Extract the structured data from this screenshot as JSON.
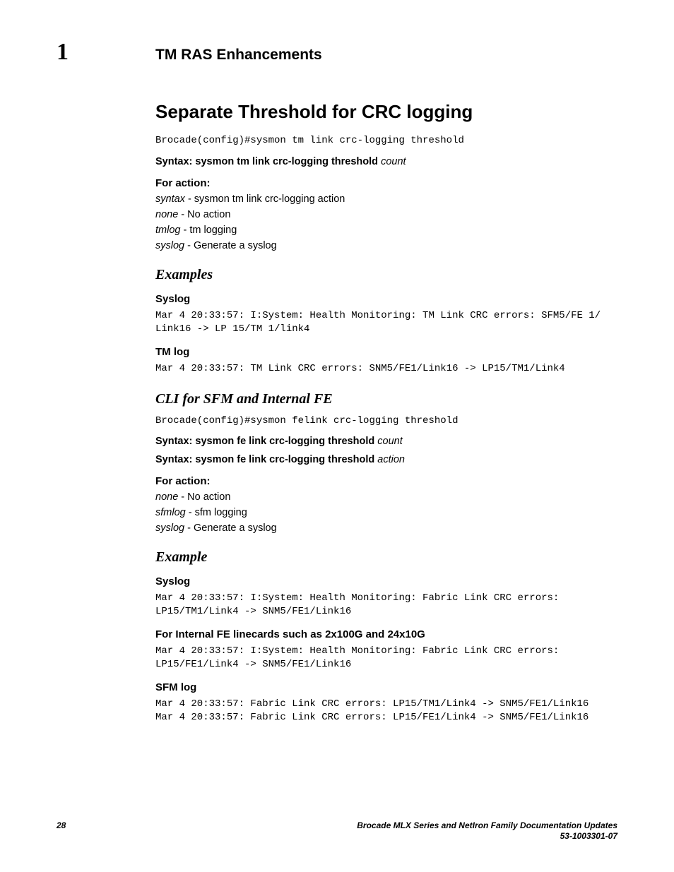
{
  "header": {
    "chapter_num": "1",
    "title": "TM RAS Enhancements"
  },
  "section": {
    "title": "Separate Threshold for CRC logging",
    "cmd1": "Brocade(config)#sysmon tm link crc-logging threshold",
    "syntax1_lead": "Syntax:  ",
    "syntax1_cmd": "sysmon tm link crc-logging threshold ",
    "syntax1_arg": "count",
    "for_action_label": "For action:",
    "action_syntax_k": "syntax",
    "action_syntax_v": " - sysmon tm link crc-logging action",
    "action_none_k": "none",
    "action_none_v": " - No action",
    "action_tmlog_k": "tmlog",
    "action_tmlog_v": " - tm logging",
    "action_syslog_k": "syslog",
    "action_syslog_v": " - Generate a syslog"
  },
  "examples1": {
    "heading": "Examples",
    "syslog_label": "Syslog",
    "syslog_text": "Mar 4 20:33:57: I:System: Health Monitoring: TM Link CRC errors: SFM5/FE 1/ Link16 -> LP 15/TM 1/link4",
    "tmlog_label": "TM log",
    "tmlog_text": "Mar 4 20:33:57: TM Link CRC errors: SNM5/FE1/Link16 -> LP15/TM1/Link4"
  },
  "cli": {
    "heading": "CLI for SFM and Internal FE",
    "cmd": "Brocade(config)#sysmon felink crc-logging threshold",
    "syntax1_lead": "Syntax:  ",
    "syntax1_cmd": "sysmon fe link crc-logging threshold ",
    "syntax1_arg": "count",
    "syntax2_lead": "Syntax:  ",
    "syntax2_cmd": "sysmon fe link crc-logging threshold ",
    "syntax2_arg": "action",
    "for_action_label": "For action:",
    "none_k": "none",
    "none_v": " - No action",
    "sfmlog_k": "sfmlog",
    "sfmlog_v": " - sfm logging",
    "syslog_k": "syslog",
    "syslog_v": " - Generate a syslog"
  },
  "example2": {
    "heading": "Example",
    "syslog_label": "Syslog",
    "syslog_text": "Mar 4 20:33:57: I:System: Health Monitoring: Fabric Link CRC errors: LP15/TM1/Link4 -> SNM5/FE1/Link16",
    "internal_label": "For Internal FE linecards such as 2x100G and 24x10G",
    "internal_text": "Mar 4 20:33:57: I:System: Health Monitoring: Fabric Link CRC errors: LP15/FE1/Link4 -> SNM5/FE1/Link16",
    "sfmlog_label": "SFM log",
    "sfmlog_text": "Mar 4 20:33:57: Fabric Link CRC errors: LP15/TM1/Link4 -> SNM5/FE1/Link16\nMar 4 20:33:57: Fabric Link CRC errors: LP15/FE1/Link4 -> SNM5/FE1/Link16"
  },
  "footer": {
    "page": "28",
    "doc_title": "Brocade MLX Series and NetIron Family Documentation Updates",
    "doc_num": "53-1003301-07"
  }
}
